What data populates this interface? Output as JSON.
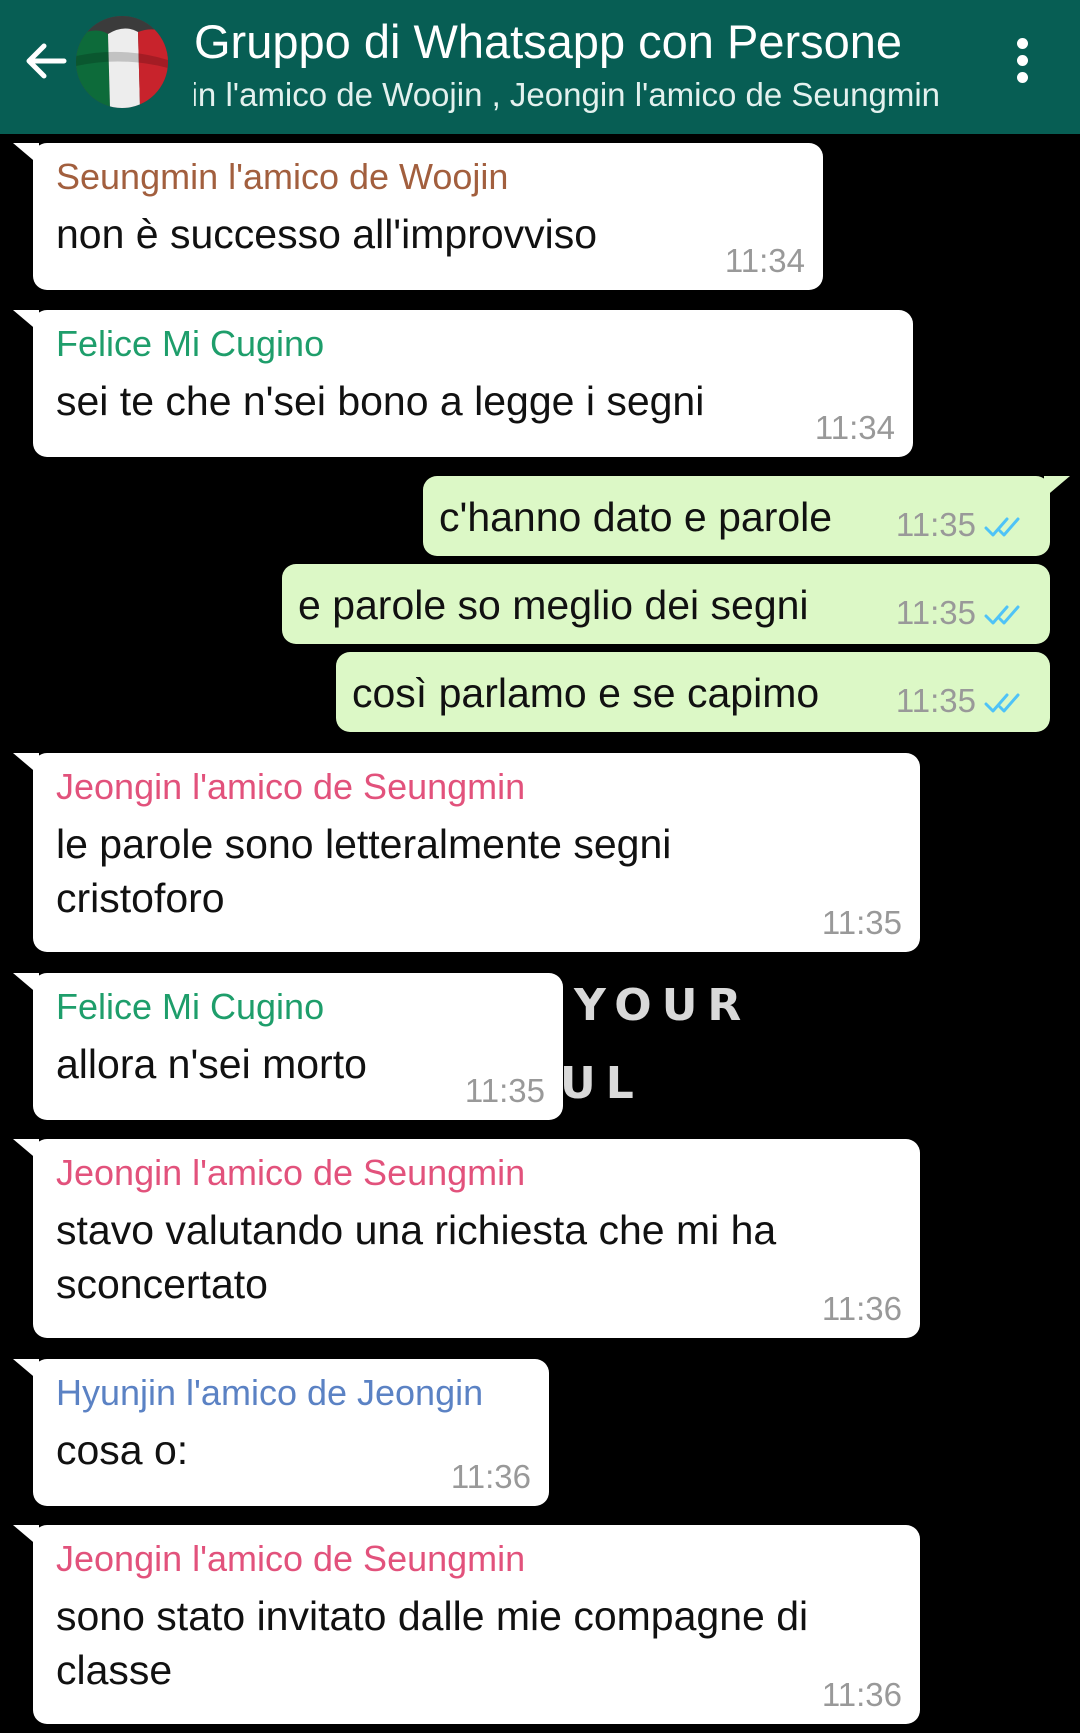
{
  "colors": {
    "header_bg": "#075e54",
    "incoming_bg": "#ffffff",
    "outgoing_bg": "#dcf8c6",
    "read_ticks": "#4fc3f7",
    "sender_seungmin": "#a25f3e",
    "sender_felice": "#1e9e6b",
    "sender_jeongin": "#e2527c",
    "sender_hyunjin": "#5b82c4"
  },
  "header": {
    "back_icon": "arrow-left-icon",
    "avatar_icon": "italian-flag-avatar",
    "title": "Gruppo di Whatsapp con Persone",
    "subtitle": "Felice Mi Cugino, Seungmin l'amico de Woojin , Jeongin l'amico de Seungmin",
    "menu_icon": "more-vertical-icon"
  },
  "background_watermark": {
    "line1": "YOUR",
    "line2": "UL"
  },
  "messages": [
    {
      "sender": "Seungmin l'amico de Woojin",
      "text": "non è successo all'improvviso",
      "time": "11:34"
    },
    {
      "sender": "Felice Mi Cugino",
      "text": "sei te che n'sei bono a legge i segni",
      "time": "11:34"
    },
    {
      "text": "c'hanno dato e parole",
      "time": "11:35"
    },
    {
      "text": "e parole so meglio dei segni",
      "time": "11:35"
    },
    {
      "text": "così parlamo e se capimo",
      "time": "11:35"
    },
    {
      "sender": "Jeongin l'amico de Seungmin",
      "text": "le parole sono letteralmente segni cristoforo",
      "time": "11:35"
    },
    {
      "sender": "Felice Mi Cugino",
      "text": "allora n'sei morto",
      "time": "11:35"
    },
    {
      "sender": "Jeongin l'amico de Seungmin",
      "text": "stavo valutando una richiesta che mi ha sconcertato",
      "time": "11:36"
    },
    {
      "sender": "Hyunjin l'amico de Jeongin",
      "text": "cosa o:",
      "time": "11:36"
    },
    {
      "sender": "Jeongin l'amico de Seungmin",
      "text": "sono stato invitato dalle mie compagne di classe",
      "time": "11:36"
    }
  ]
}
